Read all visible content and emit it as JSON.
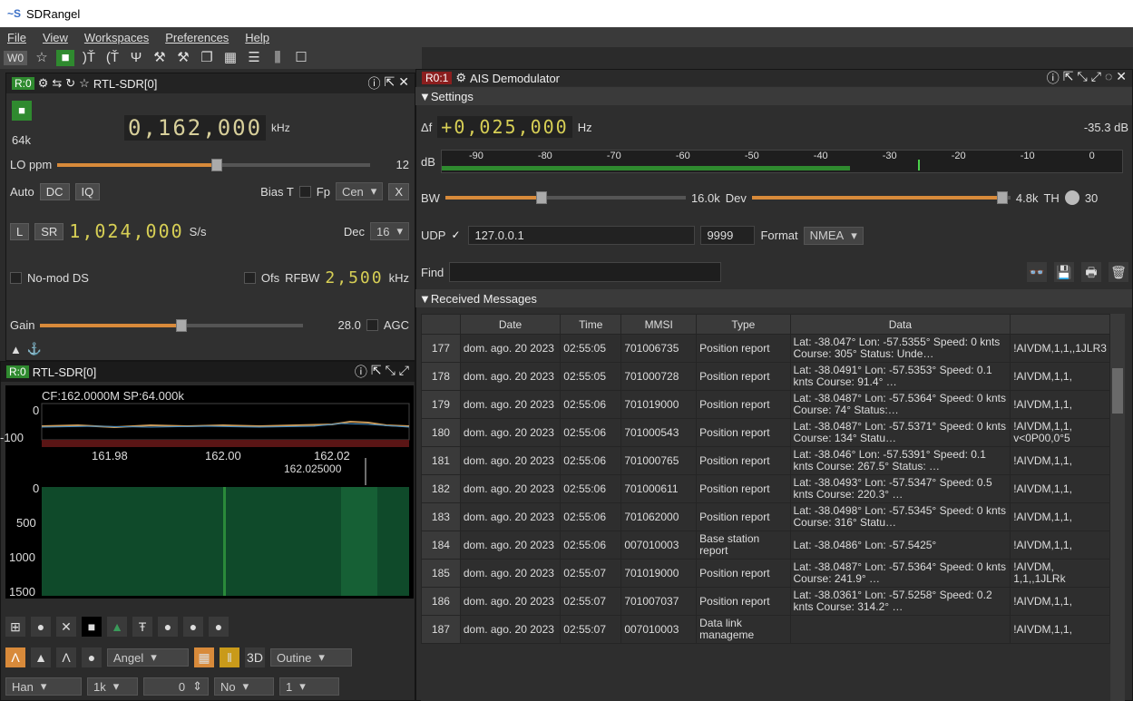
{
  "window": {
    "title": "SDRangel"
  },
  "menu": [
    "File",
    "View",
    "Workspaces",
    "Preferences",
    "Help"
  ],
  "toolbar": {
    "workspace": "W0"
  },
  "device": {
    "tag": "R:0",
    "name": "RTL-SDR[0]",
    "freq": "0,162,000",
    "freq_unit": "kHz",
    "rate": "64k",
    "lo_label": "LO ppm",
    "lo_value": "12",
    "auto": "Auto",
    "dc": "DC",
    "iq": "IQ",
    "biast": "Bias T",
    "fp": "Fp",
    "cen": "Cen",
    "x": "X",
    "l": "L",
    "sr": "SR",
    "sr_value": "1,024,000",
    "sr_unit": "S/s",
    "dec_label": "Dec",
    "dec_value": "16",
    "nomod": "No-mod DS",
    "ofs": "Ofs",
    "rfbw": "RFBW",
    "rfbw_value": "2,500",
    "rfbw_unit": "kHz",
    "gain_label": "Gain",
    "gain_value": "28.0",
    "agc": "AGC"
  },
  "spectrum": {
    "tag": "R:0",
    "name": "RTL-SDR[0]",
    "cf": "CF:162.0000M SP:64.000k",
    "y0": "0",
    "y100": "-100",
    "x1": "161.98",
    "x2": "162.00",
    "x3": "162.02",
    "marker": "162.025000",
    "w0": "0",
    "w500": "500",
    "w1000": "1000",
    "w1500": "1500",
    "angel": "Angel",
    "outline": "Outine",
    "han": "Han",
    "fft": "1k",
    "avg_value": "0",
    "no": "No",
    "one": "1"
  },
  "ais": {
    "tag": "R0:1",
    "title": "AIS Demodulator",
    "settings": "Settings",
    "df": "+0,025,000",
    "df_unit": "Hz",
    "power": "-35.3 dB",
    "db": "dB",
    "scale": [
      "-90",
      "-80",
      "-70",
      "-60",
      "-50",
      "-40",
      "-30",
      "-20",
      "-10",
      "0"
    ],
    "bw_label": "BW",
    "bw_value": "16.0k",
    "dev_label": "Dev",
    "dev_value": "4.8k",
    "th_label": "TH",
    "th_value": "30",
    "udp": "UDP",
    "udp_addr": "127.0.0.1",
    "udp_port": "9999",
    "format_label": "Format",
    "format_value": "NMEA",
    "find": "Find",
    "received": "Received Messages"
  },
  "table": {
    "headers": [
      "Date",
      "Time",
      "MMSI",
      "Type",
      "Data",
      ""
    ],
    "rows": [
      {
        "n": "177",
        "date": "dom. ago. 20 2023",
        "time": "02:55:05",
        "mmsi": "701006735",
        "type": "Position report",
        "data": "Lat: -38.047° Lon: -57.5355° Speed: 0 knts Course: 305° Status: Unde…",
        "nmea": "!AIVDM,1,1,,1JLR3"
      },
      {
        "n": "178",
        "date": "dom. ago. 20 2023",
        "time": "02:55:05",
        "mmsi": "701000728",
        "type": "Position report",
        "data": "Lat: -38.0491° Lon: -57.5353° Speed: 0.1 knts Course: 91.4° …",
        "nmea": "!AIVDM,1,1,"
      },
      {
        "n": "179",
        "date": "dom. ago. 20 2023",
        "time": "02:55:06",
        "mmsi": "701019000",
        "type": "Position report",
        "data": "Lat: -38.0487° Lon: -57.5364° Speed: 0 knts Course: 74° Status:…",
        "nmea": "!AIVDM,1,1,"
      },
      {
        "n": "180",
        "date": "dom. ago. 20 2023",
        "time": "02:55:06",
        "mmsi": "701000543",
        "type": "Position report",
        "data": "Lat: -38.0487° Lon: -57.5371° Speed: 0 knts Course: 134° Statu…",
        "nmea": "!AIVDM,1,1, v<0P00,0°5"
      },
      {
        "n": "181",
        "date": "dom. ago. 20 2023",
        "time": "02:55:06",
        "mmsi": "701000765",
        "type": "Position report",
        "data": "Lat: -38.046° Lon: -57.5391° Speed: 0.1 knts Course: 267.5° Status: …",
        "nmea": "!AIVDM,1,1,"
      },
      {
        "n": "182",
        "date": "dom. ago. 20 2023",
        "time": "02:55:06",
        "mmsi": "701000611",
        "type": "Position report",
        "data": "Lat: -38.0493° Lon: -57.5347° Speed: 0.5 knts Course: 220.3° …",
        "nmea": "!AIVDM,1,1,"
      },
      {
        "n": "183",
        "date": "dom. ago. 20 2023",
        "time": "02:55:06",
        "mmsi": "701062000",
        "type": "Position report",
        "data": "Lat: -38.0498° Lon: -57.5345° Speed: 0 knts Course: 316° Statu…",
        "nmea": "!AIVDM,1,1,"
      },
      {
        "n": "184",
        "date": "dom. ago. 20 2023",
        "time": "02:55:06",
        "mmsi": "007010003",
        "type": "Base station report",
        "data": "Lat: -38.0486° Lon: -57.5425°",
        "nmea": "!AIVDM,1,1,"
      },
      {
        "n": "185",
        "date": "dom. ago. 20 2023",
        "time": "02:55:07",
        "mmsi": "701019000",
        "type": "Position report",
        "data": "Lat: -38.0487° Lon: -57.5364° Speed: 0 knts Course: 241.9° …",
        "nmea": "!AIVDM, 1,1,,1JLRk"
      },
      {
        "n": "186",
        "date": "dom. ago. 20 2023",
        "time": "02:55:07",
        "mmsi": "701007037",
        "type": "Position report",
        "data": "Lat: -38.0361° Lon: -57.5258° Speed: 0.2 knts Course: 314.2° …",
        "nmea": "!AIVDM,1,1,"
      },
      {
        "n": "187",
        "date": "dom. ago. 20 2023",
        "time": "02:55:07",
        "mmsi": "007010003",
        "type": "Data link manageme",
        "data": "",
        "nmea": "!AIVDM,1,1,"
      }
    ]
  }
}
